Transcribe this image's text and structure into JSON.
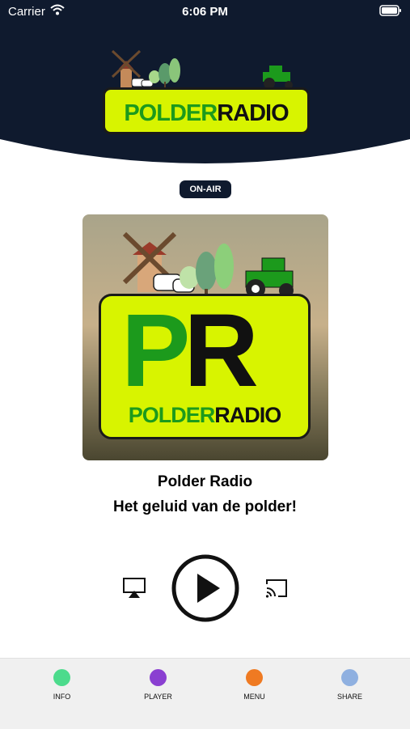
{
  "status_bar": {
    "carrier": "Carrier",
    "time": "6:06 PM"
  },
  "header": {
    "logo_text_green": "POLDER",
    "logo_text_black": "RADIO",
    "background": "#0f1a2e"
  },
  "onair": {
    "label": "ON-AIR"
  },
  "artwork": {
    "monogram_p": "P",
    "monogram_r": "R",
    "name_green": "POLDER",
    "name_black": "RADIO"
  },
  "station": {
    "name": "Polder Radio",
    "tagline": "Het geluid van de polder!"
  },
  "controls": {
    "airplay_icon": "airplay-icon",
    "play_icon": "play-icon",
    "cast_icon": "cast-icon"
  },
  "tabs": [
    {
      "label": "INFO",
      "color": "#4cdb8c"
    },
    {
      "label": "PLAYER",
      "color": "#8a3fd1"
    },
    {
      "label": "MENU",
      "color": "#ef7a22"
    },
    {
      "label": "SHARE",
      "color": "#8fb0e0"
    }
  ],
  "colors": {
    "accent_lime": "#d8f400",
    "logo_green": "#1c9a1c",
    "navy": "#0f1a2e"
  }
}
